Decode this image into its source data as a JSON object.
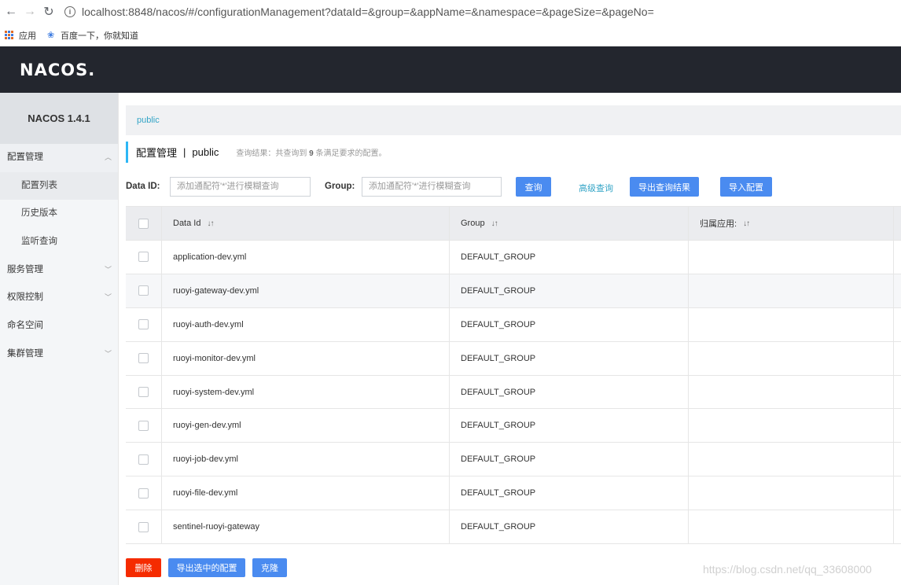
{
  "browser": {
    "url": "localhost:8848/nacos/#/configurationManagement?dataId=&group=&appName=&namespace=&pageSize=&pageNo=",
    "bookmarks": [
      "应用",
      "百度一下，你就知道"
    ]
  },
  "header": {
    "logo_text": "NACOS."
  },
  "sidebar": {
    "version": "NACOS 1.4.1",
    "groups": [
      {
        "label": "配置管理",
        "expanded": true,
        "items": [
          "配置列表",
          "历史版本",
          "监听查询"
        ]
      },
      {
        "label": "服务管理",
        "expanded": false
      },
      {
        "label": "权限控制",
        "expanded": false
      },
      {
        "label": "命名空间",
        "expanded": false
      },
      {
        "label": "集群管理",
        "expanded": false
      }
    ]
  },
  "breadcrumb": {
    "namespace": "public"
  },
  "title": {
    "main": "配置管理",
    "separator": "|",
    "namespace": "public",
    "hint_prefix": "查询结果：共查询到",
    "hint_count": "9",
    "hint_suffix": "条满足要求的配置。"
  },
  "filters": {
    "dataid_label": "Data ID:",
    "dataid_placeholder": "添加通配符'*'进行模糊查询",
    "group_label": "Group:",
    "group_placeholder": "添加通配符'*'进行模糊查询",
    "query_button": "查询",
    "advanced_link": "高级查询",
    "export_button": "导出查询结果",
    "import_button": "导入配置"
  },
  "table": {
    "columns": [
      "Data Id",
      "Group",
      "归属应用:"
    ],
    "rows": [
      {
        "data_id": "application-dev.yml",
        "group": "DEFAULT_GROUP",
        "app": ""
      },
      {
        "data_id": "ruoyi-gateway-dev.yml",
        "group": "DEFAULT_GROUP",
        "app": ""
      },
      {
        "data_id": "ruoyi-auth-dev.yml",
        "group": "DEFAULT_GROUP",
        "app": ""
      },
      {
        "data_id": "ruoyi-monitor-dev.yml",
        "group": "DEFAULT_GROUP",
        "app": ""
      },
      {
        "data_id": "ruoyi-system-dev.yml",
        "group": "DEFAULT_GROUP",
        "app": ""
      },
      {
        "data_id": "ruoyi-gen-dev.yml",
        "group": "DEFAULT_GROUP",
        "app": ""
      },
      {
        "data_id": "ruoyi-job-dev.yml",
        "group": "DEFAULT_GROUP",
        "app": ""
      },
      {
        "data_id": "ruoyi-file-dev.yml",
        "group": "DEFAULT_GROUP",
        "app": ""
      },
      {
        "data_id": "sentinel-ruoyi-gateway",
        "group": "DEFAULT_GROUP",
        "app": ""
      }
    ]
  },
  "footer": {
    "delete_button": "删除",
    "export_selected_button": "导出选中的配置",
    "clone_button": "克隆"
  },
  "watermark": "https://blog.csdn.net/qq_33608000",
  "colors": {
    "header_bg": "#23262e",
    "primary": "#4a8bf0",
    "danger": "#f52b00",
    "link": "#33a4c6"
  }
}
